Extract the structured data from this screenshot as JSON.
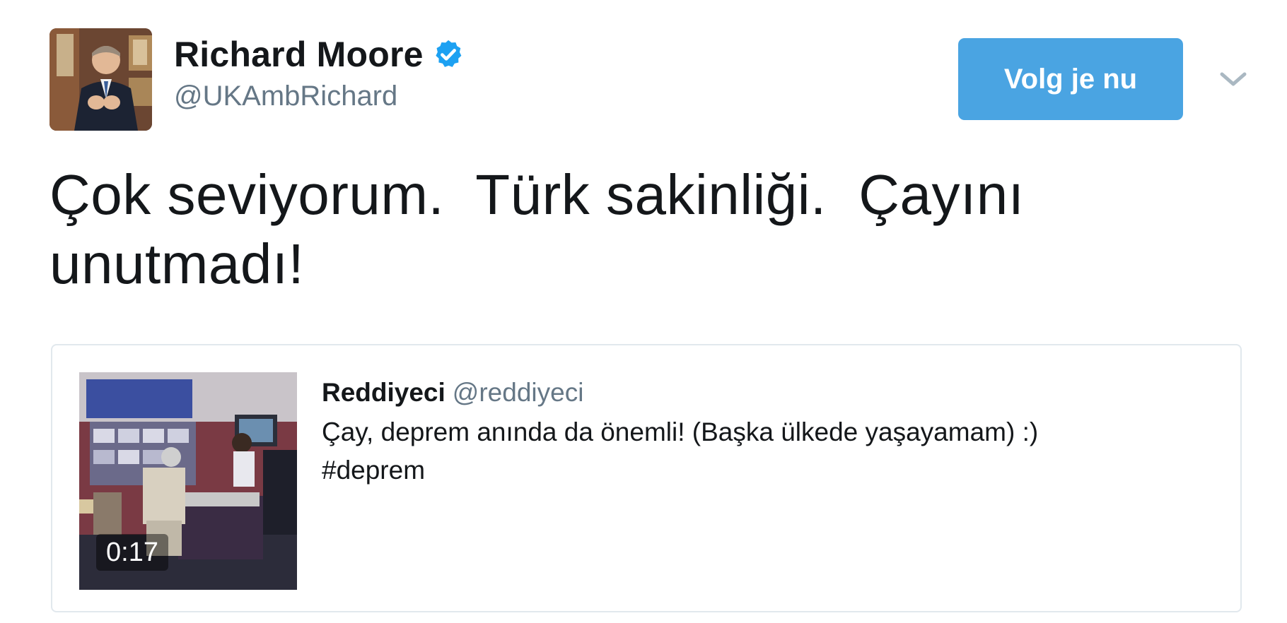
{
  "header": {
    "display_name": "Richard Moore",
    "screen_name": "@UKAmbRichard",
    "follow_label": "Volg je nu",
    "verified_icon": "verified-badge-icon",
    "menu_icon": "chevron-down-icon"
  },
  "tweet": {
    "text": "Çok seviyorum.  Türk sakinliği.  Çayını\nunutmadı!"
  },
  "quote": {
    "author_name": "Reddiyeci",
    "author_handle": "@reddiyeci",
    "text": "Çay, deprem anında da önemli! (Başka ülkede yaşayamam) :)\n#deprem",
    "video_duration": "0:17"
  },
  "colors": {
    "follow_button": "#4aa4e2",
    "verified": "#1da1f2",
    "secondary_text": "#657786",
    "border": "#e1e8ed"
  }
}
